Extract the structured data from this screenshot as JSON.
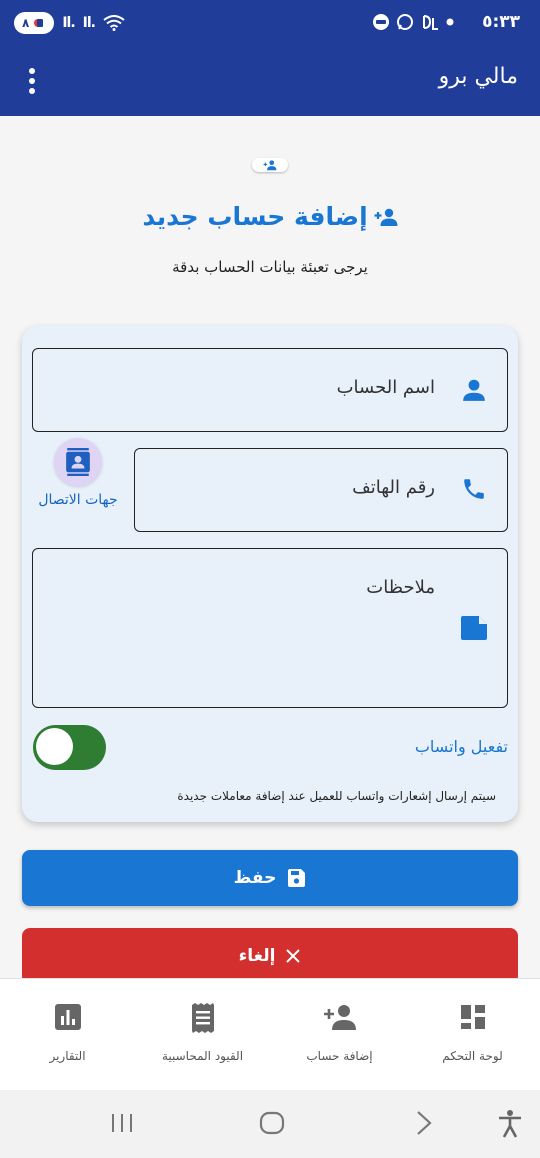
{
  "status_bar": {
    "time": "٥:٣٣",
    "battery": "٨"
  },
  "app_bar": {
    "title": "مالي برو"
  },
  "header": {
    "title": "إضافة حساب جديد",
    "subtitle": "يرجى تعبئة بيانات الحساب بدقة"
  },
  "form": {
    "account_name_label": "اسم الحساب",
    "phone_label": "رقم الهاتف",
    "contacts_label": "جهات الاتصال",
    "notes_label": "ملاحظات",
    "whatsapp_toggle_label": "تفعيل واتساب",
    "whatsapp_enabled": true,
    "whatsapp_note": "سيتم إرسال إشعارات واتساب للعميل عند إضافة معاملات جديدة"
  },
  "buttons": {
    "save": "حفظ",
    "cancel": "إلغاء"
  },
  "bottom_nav": [
    {
      "label": "لوحة التحكم",
      "icon": "dashboard-icon"
    },
    {
      "label": "إضافة حساب",
      "icon": "person-add-icon"
    },
    {
      "label": "القيود المحاسبية",
      "icon": "receipt-icon"
    },
    {
      "label": "التقارير",
      "icon": "reports-icon"
    }
  ],
  "colors": {
    "primary": "#1f3d99",
    "accent": "#1976d2",
    "danger": "#d32f2f",
    "toggle_on": "#2e7d32",
    "card_bg": "#e8f0fa"
  }
}
